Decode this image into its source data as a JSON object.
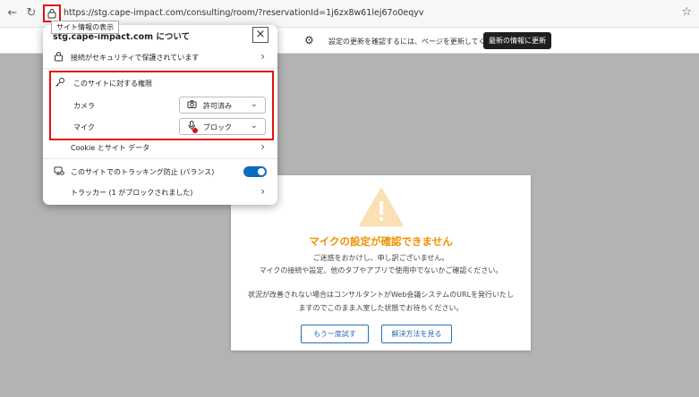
{
  "browser": {
    "url": "https://stg.cape-impact.com/consulting/room/?reservationId=1j6zx8w61lej67o0eqyv",
    "tooltip": "サイト情報の表示"
  },
  "app_header": {
    "update_message": "設定の更新を確認するには、ページを更新してください",
    "update_button": "最新の情報に更新"
  },
  "popup": {
    "title": "stg.cape-impact.com について",
    "security_label": "接続がセキュリティで保護されています",
    "permissions_title": "このサイトに対する権限",
    "camera_label": "カメラ",
    "camera_value": "許可済み",
    "mic_label": "マイク",
    "mic_value": "ブロック",
    "cookie_label": "Cookie とサイト データ",
    "tracking_label": "このサイトでのトラッキング防止 (バランス)",
    "trackers_label": "トラッカー (1 がブロックされました)",
    "tracking_enabled": true
  },
  "dialog": {
    "title": "マイクの設定が確認できません",
    "line1": "ご迷惑をおかけし、申し訳ございません。",
    "line2": "マイクの接続や設定、他のタブやアプリで使用中でないかご確認ください。",
    "line3": "状況が改善されない場合はコンサルタントがWeb会議システムのURLを発行いたし",
    "line4": "ますのでこのまま入室した状態でお待ちください。",
    "retry_button": "もう一度試す",
    "solution_button": "解決方法を見る"
  },
  "colors": {
    "highlight_red": "#e30f0f",
    "warning_orange": "#f09200",
    "link_blue": "#2a6bbf",
    "toggle_blue": "#0f6cbd"
  }
}
